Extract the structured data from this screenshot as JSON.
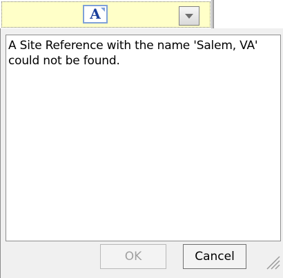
{
  "toolbar": {
    "font_icon": "A",
    "dropdown_icon": "chevron-down-icon"
  },
  "dialog": {
    "message": "A Site Reference with the name 'Salem, VA' could not be found.",
    "ok_label": "OK",
    "cancel_label": "Cancel"
  },
  "colors": {
    "toolbar_bg": "#ffffc8",
    "dialog_bg": "#f0f0f0",
    "disabled_text": "#a0a0a0"
  }
}
